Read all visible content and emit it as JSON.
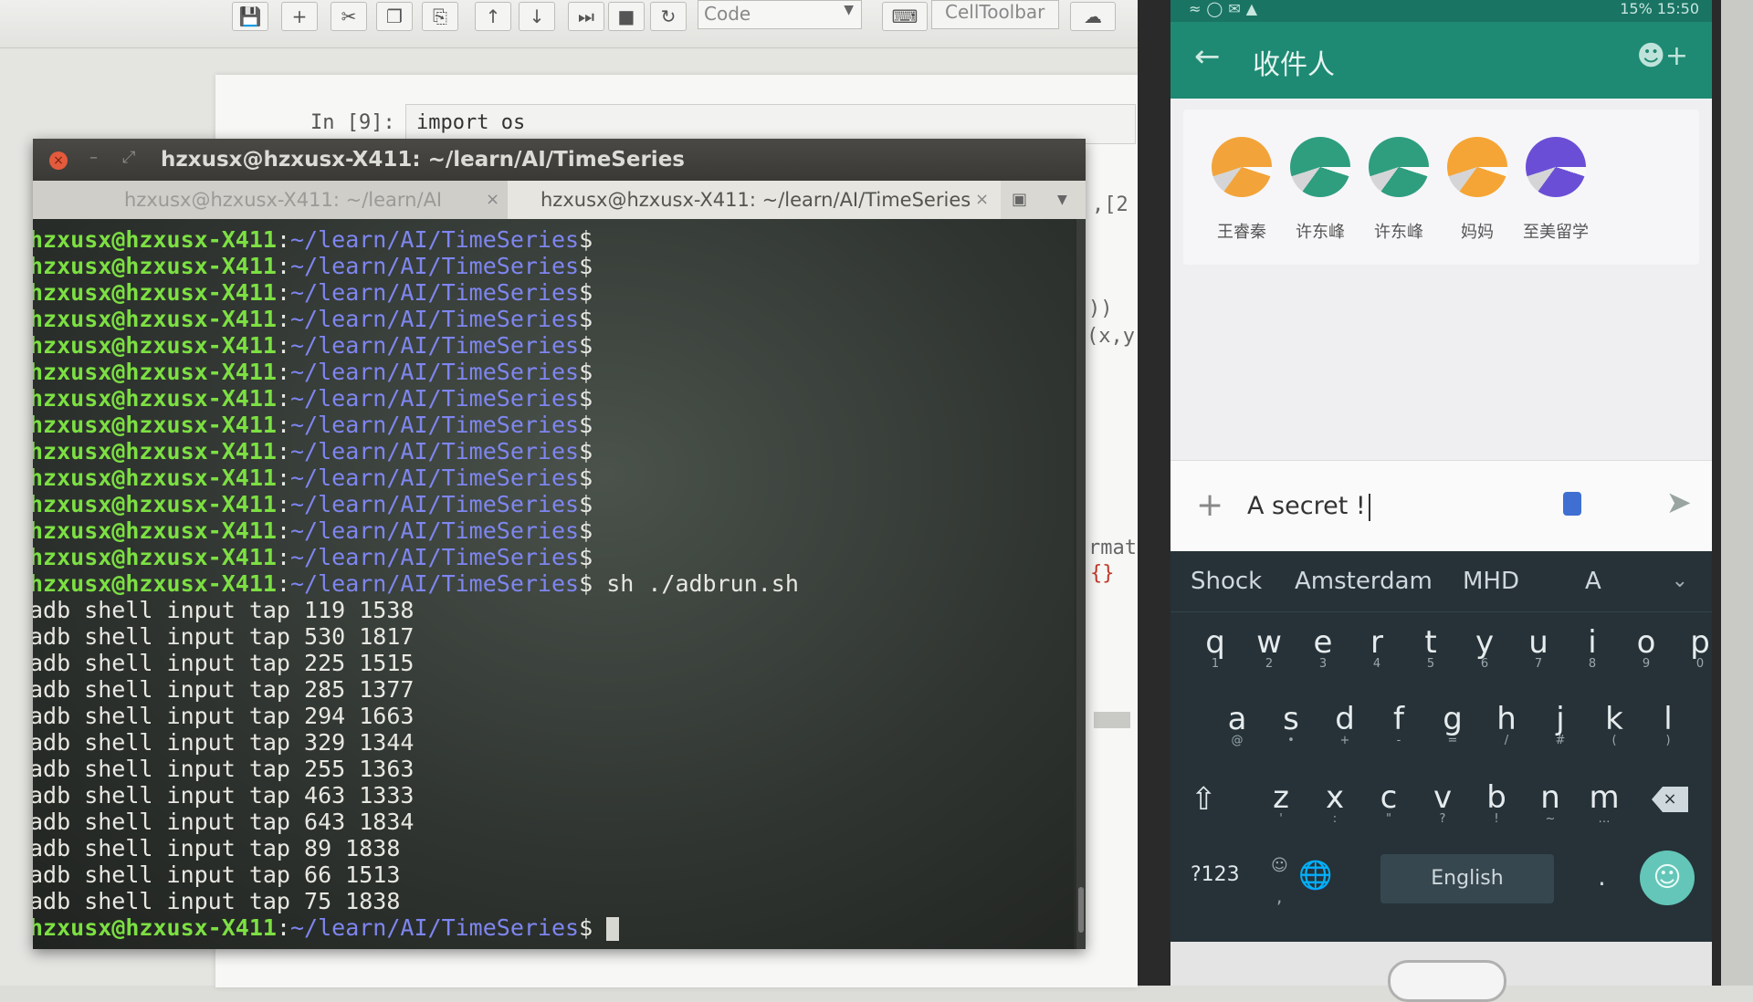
{
  "jupyter": {
    "toolbar_icons": [
      "save-icon",
      "plus-icon",
      "cut-icon",
      "copy-icon",
      "paste-icon",
      "arrow-up-icon",
      "arrow-down-icon",
      "skip-icon",
      "stop-icon",
      "restart-icon"
    ],
    "cell_type": "Code",
    "celltoolbar_label": "CellToolbar",
    "cell_prompt": "In [9]:",
    "cell_code": "import os",
    "fragments": [
      ",[2",
      "))",
      "(x,y",
      "rmat",
      "{}"
    ]
  },
  "terminal": {
    "title": "hzxusx@hzxusx-X411: ~/learn/AI/TimeSeries",
    "tabs": [
      {
        "label": "hzxusx@hzxusx-X411: ~/learn/AI",
        "close": "×"
      },
      {
        "label": "hzxusx@hzxusx-X411: ~/learn/AI/TimeSeries",
        "close": "×"
      }
    ],
    "prompt_user": "hzxusx@hzxusx-X411",
    "prompt_path": "~/learn/AI/TimeSeries",
    "prompt_sep": ":",
    "prompt_end": "$",
    "empty_prompt_count": 13,
    "command": " sh ./adbrun.sh",
    "output": [
      "adb shell input tap 119 1538",
      "adb shell input tap 530 1817",
      "adb shell input tap 225 1515",
      "adb shell input tap 285 1377",
      "adb shell input tap 294 1663",
      "adb shell input tap 329 1344",
      "adb shell input tap 255 1363",
      "adb shell input tap 463 1333",
      "adb shell input tap 643 1834",
      "adb shell input tap 89 1838",
      "adb shell input tap 66 1513",
      "adb shell input tap 75 1838"
    ]
  },
  "phone": {
    "status_time": "15% 15:50",
    "appbar_title": "收件人",
    "contacts": [
      {
        "name": "王睿秦",
        "color": "#f2a43a"
      },
      {
        "name": "许东峰",
        "color": "#2e9e7f"
      },
      {
        "name": "许东峰",
        "color": "#2e9e7f"
      },
      {
        "name": "妈妈",
        "color": "#f5a535"
      },
      {
        "name": "至美留学",
        "color": "#6a4fd6"
      }
    ],
    "compose_text": "A secret !",
    "suggestions": [
      "Shock",
      "Amsterdam",
      "MHD",
      "A"
    ],
    "keyboard": {
      "row1": [
        [
          "q",
          "1"
        ],
        [
          "w",
          "2"
        ],
        [
          "e",
          "3"
        ],
        [
          "r",
          "4"
        ],
        [
          "t",
          "5"
        ],
        [
          "y",
          "6"
        ],
        [
          "u",
          "7"
        ],
        [
          "i",
          "8"
        ],
        [
          "o",
          "9"
        ],
        [
          "p",
          "0"
        ]
      ],
      "row2": [
        [
          "a",
          "@"
        ],
        [
          "s",
          "•"
        ],
        [
          "d",
          "+"
        ],
        [
          "f",
          "-"
        ],
        [
          "g",
          "="
        ],
        [
          "h",
          "/"
        ],
        [
          "j",
          "#"
        ],
        [
          "k",
          "("
        ],
        [
          "l",
          ")"
        ]
      ],
      "row3": [
        [
          "z",
          "'"
        ],
        [
          "x",
          ":"
        ],
        [
          "c",
          "\""
        ],
        [
          "v",
          "?"
        ],
        [
          "b",
          "!"
        ],
        [
          "n",
          "~"
        ],
        [
          "m",
          "…"
        ]
      ],
      "symbols_label": "?123",
      "space_label": "English",
      "period": "."
    }
  }
}
